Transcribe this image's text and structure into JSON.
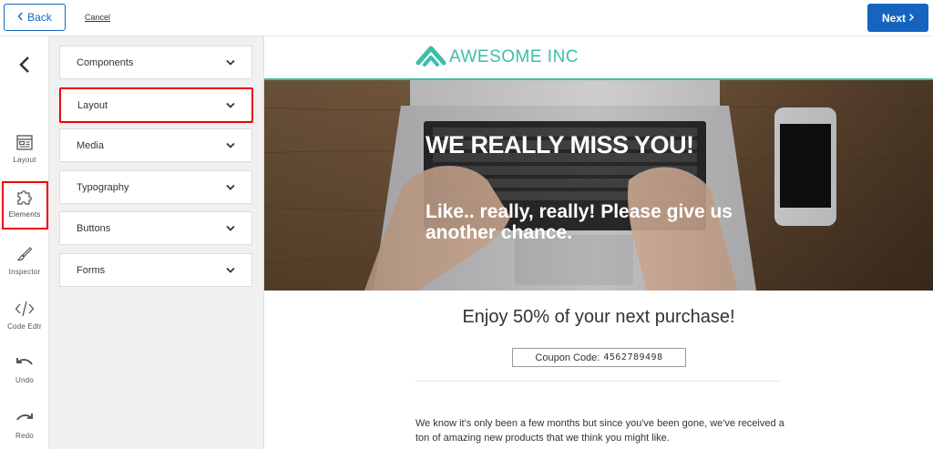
{
  "topbar": {
    "back_label": "Back",
    "cancel_label": "Cancel",
    "next_label": "Next"
  },
  "rail": {
    "items": [
      {
        "label": "Layout",
        "icon": "layout-icon"
      },
      {
        "label": "Elements",
        "icon": "puzzle-icon"
      },
      {
        "label": "Inspector",
        "icon": "brush-icon"
      },
      {
        "label": "Code Edtr",
        "icon": "code-icon"
      },
      {
        "label": "Undo",
        "icon": "undo-icon"
      },
      {
        "label": "Redo",
        "icon": "redo-icon"
      }
    ]
  },
  "panel": {
    "items": [
      {
        "label": "Components"
      },
      {
        "label": "Layout"
      },
      {
        "label": "Media"
      },
      {
        "label": "Typography"
      },
      {
        "label": "Buttons"
      },
      {
        "label": "Forms"
      }
    ]
  },
  "preview": {
    "logo_text": "AWESOME INC",
    "hero_title": "WE REALLY MISS YOU!",
    "hero_subtitle": "Like.. really, really! Please give us another chance.",
    "offer": "Enjoy 50% of your next purchase!",
    "coupon_label": "Coupon Code:",
    "coupon_code": "4562789498",
    "body": "We know it's only been a few months but since you've been gone, we've received a ton of amazing new products that we think you might like."
  },
  "colors": {
    "accent": "#1565c0",
    "brand_teal": "#3bbfa7",
    "highlight": "#e00000"
  }
}
